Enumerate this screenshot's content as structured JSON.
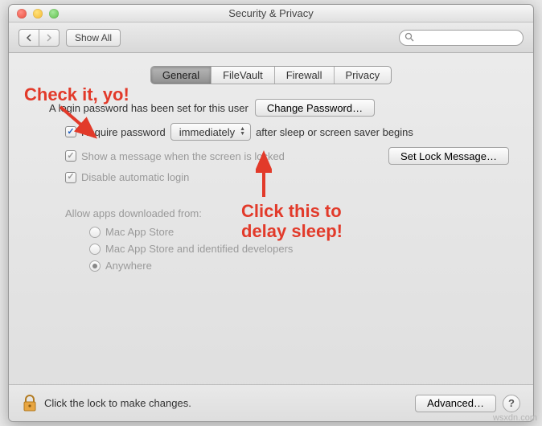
{
  "window": {
    "title": "Security & Privacy"
  },
  "toolbar": {
    "show_all": "Show All",
    "search_placeholder": ""
  },
  "tabs": {
    "general": "General",
    "filevault": "FileVault",
    "firewall": "Firewall",
    "privacy": "Privacy"
  },
  "general": {
    "login_password_set": "A login password has been set for this user",
    "change_password": "Change Password…",
    "require_password": "Require password",
    "delay_value": "immediately",
    "after_sleep": "after sleep or screen saver begins",
    "show_message": "Show a message when the screen is locked",
    "set_lock_message": "Set Lock Message…",
    "disable_auto_login": "Disable automatic login",
    "allow_apps_label": "Allow apps downloaded from:",
    "radio_mas": "Mac App Store",
    "radio_mas_dev": "Mac App Store and identified developers",
    "radio_anywhere": "Anywhere"
  },
  "footer": {
    "lock_text": "Click the lock to make changes.",
    "advanced": "Advanced…"
  },
  "annotations": {
    "check_it": "Check it, yo!",
    "click_this": "Click this to\ndelay sleep!"
  },
  "watermark": "wsxdn.com"
}
